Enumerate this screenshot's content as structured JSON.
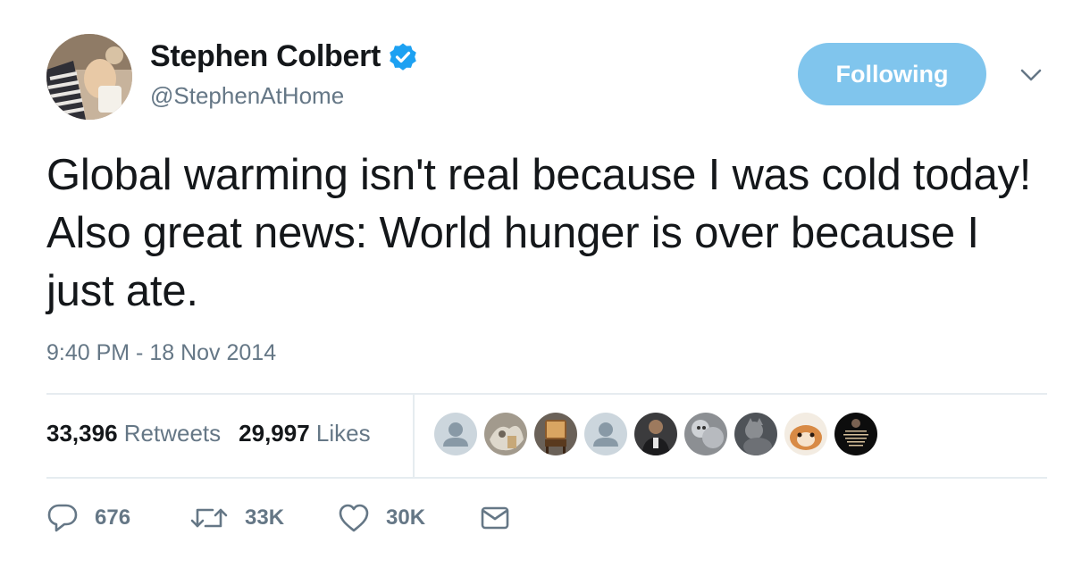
{
  "author": {
    "name": "Stephen Colbert",
    "handle": "@StephenAtHome",
    "verified_icon": "verified-badge-icon",
    "avatar_icon": "profile-photo"
  },
  "follow_button": {
    "label": "Following",
    "color": "#80c5ed"
  },
  "menu": {
    "icon": "chevron-down-icon"
  },
  "tweet": {
    "text": "Global warming isn't real because I was cold today! Also great news: World hunger is over because I just ate.",
    "timestamp": "9:40 PM - 18 Nov 2014"
  },
  "stats": {
    "retweets_count": "33,396",
    "retweets_label": "Retweets",
    "likes_count": "29,997",
    "likes_label": "Likes"
  },
  "likers": [
    {
      "kind": "default-avatar"
    },
    {
      "kind": "photo"
    },
    {
      "kind": "photo"
    },
    {
      "kind": "default-avatar"
    },
    {
      "kind": "photo"
    },
    {
      "kind": "photo"
    },
    {
      "kind": "photo"
    },
    {
      "kind": "photo"
    },
    {
      "kind": "photo"
    }
  ],
  "actions": {
    "reply_count": "676",
    "retweet_count": "33K",
    "like_count": "30K",
    "reply_icon": "reply-icon",
    "retweet_icon": "retweet-icon",
    "like_icon": "heart-icon",
    "message_icon": "envelope-icon"
  },
  "colors": {
    "text_primary": "#14171a",
    "text_secondary": "#657786",
    "verified_blue": "#1da1f2",
    "divider": "#e6ecf0"
  }
}
